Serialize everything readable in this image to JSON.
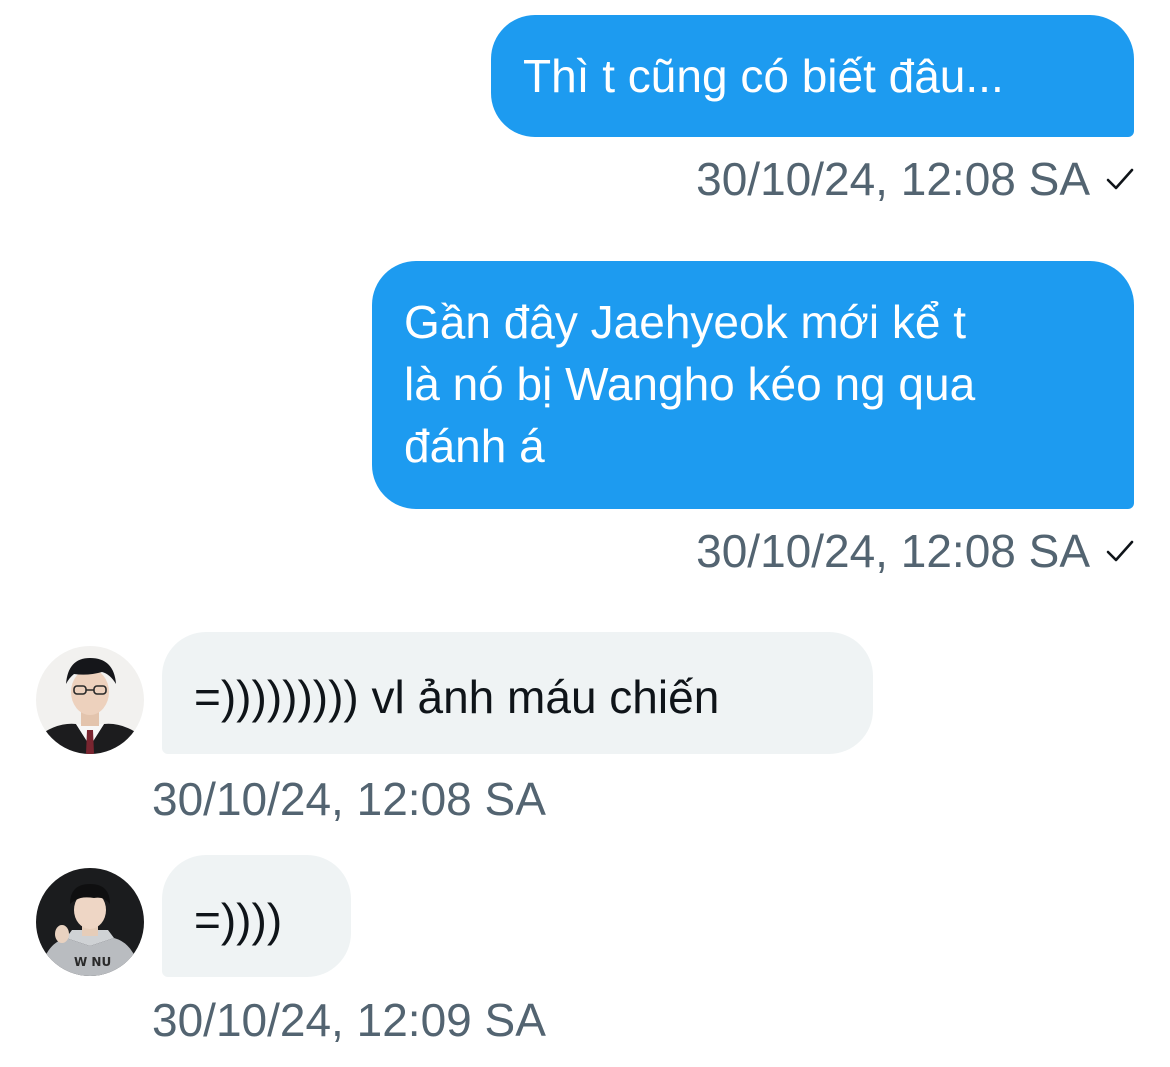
{
  "messages": [
    {
      "direction": "outgoing",
      "text": "Thì t cũng có biết đâu...",
      "timestamp": "30/10/24, 12:08 SA",
      "status_icon": "check-icon"
    },
    {
      "direction": "outgoing",
      "text": "Gần đây Jaehyeok mới kể t\nlà nó bị Wangho kéo ng qua\nđánh á",
      "timestamp": "30/10/24, 12:08 SA",
      "status_icon": "check-icon"
    },
    {
      "direction": "incoming",
      "text": "=))))))))) vl ảnh máu chiến",
      "timestamp": "30/10/24, 12:08 SA",
      "avatar": "user-avatar"
    },
    {
      "direction": "incoming",
      "text": "=))))",
      "timestamp": "30/10/24, 12:09 SA",
      "avatar": "user-avatar"
    }
  ],
  "colors": {
    "outgoing_bubble": "#1d9bf0",
    "incoming_bubble": "#eff3f4",
    "timestamp": "#536471",
    "incoming_text": "#0f1419"
  }
}
